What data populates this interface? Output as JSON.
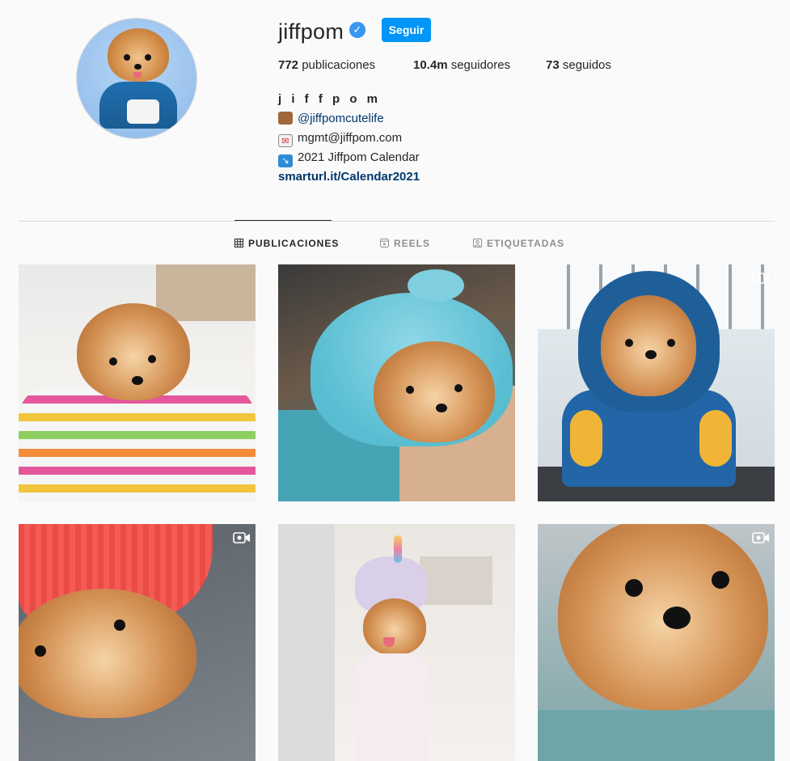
{
  "profile": {
    "username": "jiffpom",
    "verified_mark": "✓",
    "follow_label": "Seguir",
    "stats": {
      "posts_count": "772",
      "posts_label": " publicaciones",
      "followers_count": "10.4m",
      "followers_label": " seguidores",
      "following_count": "73",
      "following_label": " seguidos"
    },
    "bio": {
      "name": "j i f f p o m",
      "line1_icon": "bear-emoji-icon",
      "line1": "@jiffpomcutelife",
      "line2_icon": "envelope-emoji-icon",
      "line2": "mgmt@jiffpom.com",
      "line3_icon": "arrow-emoji-icon",
      "line3": "2021 Jiffpom Calendar",
      "link": "smarturl.it/Calendar2021"
    }
  },
  "tabs": [
    {
      "label": "PUBLICACIONES",
      "icon": "grid-icon",
      "active": true
    },
    {
      "label": "REELS",
      "icon": "reels-icon",
      "active": false
    },
    {
      "label": "ETIQUETADAS",
      "icon": "tagged-icon",
      "active": false
    }
  ],
  "posts": [
    {
      "scene": "dog in striped pet bed",
      "video": false
    },
    {
      "scene": "dog in blue knit hat in bag",
      "video": false
    },
    {
      "scene": "dog in blue hoodie",
      "video": true
    },
    {
      "scene": "dog in red beanie",
      "video": true
    },
    {
      "scene": "dog in unicorn panda hat",
      "video": false
    },
    {
      "scene": "dog close-up face",
      "video": true
    }
  ],
  "colors": {
    "accent": "#0095f6",
    "verified": "#3897f0",
    "link": "#00376b",
    "text": "#262626",
    "muted": "#8e8e8e",
    "background": "#fafafa"
  }
}
